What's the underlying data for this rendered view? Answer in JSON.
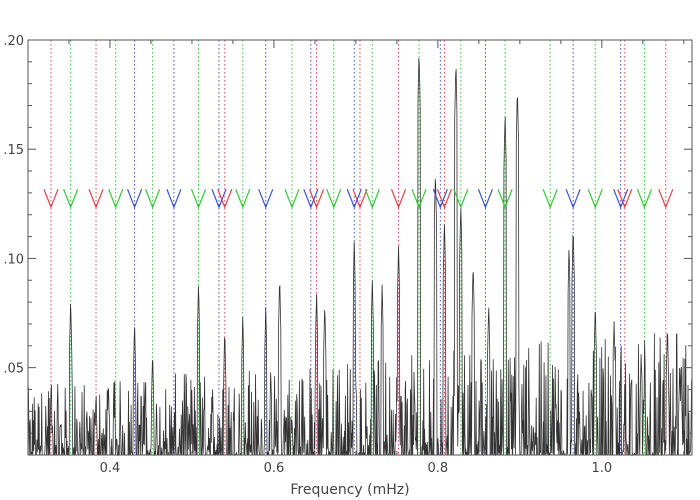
{
  "chart_data": {
    "type": "line",
    "title": "",
    "xlabel": "Frequency (mHz)",
    "ylabel": "",
    "xlim": [
      0.3,
      1.11
    ],
    "ylim": [
      0.01,
      0.2
    ],
    "x_ticks": [
      0.4,
      0.6,
      0.8,
      1.0
    ],
    "x_tick_labels": [
      "0.4",
      "0.6",
      "0.8",
      "1.0"
    ],
    "y_ticks": [
      0.05,
      0.1,
      0.15,
      0.2
    ],
    "y_tick_labels": [
      ".05",
      ".10",
      ".15",
      ".20"
    ],
    "grid": false,
    "line_color": "#333333",
    "marker_level": 0.128,
    "colors": {
      "red": "#e8424a",
      "green": "#35c93a",
      "blue": "#3e55d6"
    },
    "mode_markers": {
      "red": [
        0.328,
        0.383,
        0.54,
        0.652,
        0.705,
        0.752,
        0.808,
        1.028,
        1.078
      ],
      "green": [
        0.352,
        0.407,
        0.452,
        0.508,
        0.562,
        0.622,
        0.673,
        0.72,
        0.777,
        0.828,
        0.882,
        0.937,
        0.992,
        1.052
      ],
      "blue": [
        0.43,
        0.478,
        0.533,
        0.59,
        0.645,
        0.698,
        0.803,
        0.858,
        0.965,
        1.023
      ]
    },
    "peaks": [
      {
        "x": 0.328,
        "y": 0.041
      },
      {
        "x": 0.352,
        "y": 0.082
      },
      {
        "x": 0.383,
        "y": 0.04
      },
      {
        "x": 0.398,
        "y": 0.045
      },
      {
        "x": 0.43,
        "y": 0.071
      },
      {
        "x": 0.452,
        "y": 0.058
      },
      {
        "x": 0.508,
        "y": 0.089
      },
      {
        "x": 0.54,
        "y": 0.068
      },
      {
        "x": 0.562,
        "y": 0.075
      },
      {
        "x": 0.59,
        "y": 0.078
      },
      {
        "x": 0.607,
        "y": 0.092
      },
      {
        "x": 0.652,
        "y": 0.085
      },
      {
        "x": 0.662,
        "y": 0.08
      },
      {
        "x": 0.698,
        "y": 0.108
      },
      {
        "x": 0.72,
        "y": 0.092
      },
      {
        "x": 0.732,
        "y": 0.088
      },
      {
        "x": 0.752,
        "y": 0.106
      },
      {
        "x": 0.777,
        "y": 0.195
      },
      {
        "x": 0.797,
        "y": 0.14
      },
      {
        "x": 0.808,
        "y": 0.118
      },
      {
        "x": 0.822,
        "y": 0.19
      },
      {
        "x": 0.828,
        "y": 0.125
      },
      {
        "x": 0.843,
        "y": 0.098
      },
      {
        "x": 0.862,
        "y": 0.08
      },
      {
        "x": 0.882,
        "y": 0.167
      },
      {
        "x": 0.897,
        "y": 0.178
      },
      {
        "x": 0.96,
        "y": 0.106
      },
      {
        "x": 0.965,
        "y": 0.115
      },
      {
        "x": 0.992,
        "y": 0.08
      },
      {
        "x": 1.015,
        "y": 0.072
      },
      {
        "x": 1.048,
        "y": 0.058
      },
      {
        "x": 1.08,
        "y": 0.07
      },
      {
        "x": 1.095,
        "y": 0.052
      }
    ],
    "noise_floor": 0.01
  }
}
